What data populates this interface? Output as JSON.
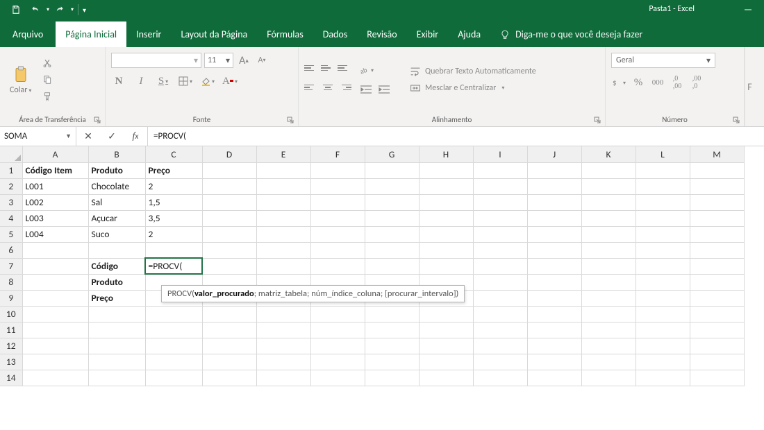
{
  "titlebar": {
    "title": "Pasta1  -  Excel"
  },
  "tabs": {
    "file": "Arquivo",
    "home": "Página Inicial",
    "insert": "Inserir",
    "page_layout": "Layout da Página",
    "formulas": "Fórmulas",
    "data": "Dados",
    "review": "Revisão",
    "view": "Exibir",
    "help": "Ajuda",
    "tell_me": "Diga-me o que você deseja fazer"
  },
  "ribbon": {
    "clipboard": {
      "paste": "Colar",
      "group": "Área de Transferência"
    },
    "font": {
      "size": "11",
      "bold": "N",
      "italic": "I",
      "underline": "S",
      "group": "Fonte",
      "grow": "A",
      "shrink": "A"
    },
    "alignment": {
      "wrap": "Quebrar Texto Automaticamente",
      "merge": "Mesclar e Centralizar",
      "group": "Alinhamento"
    },
    "number": {
      "format": "Geral",
      "group": "Número"
    },
    "edge": "F"
  },
  "namebox": "SOMA",
  "formula_bar": "=PROCV(",
  "columns": [
    "A",
    "B",
    "C",
    "D",
    "E",
    "F",
    "G",
    "H",
    "I",
    "J",
    "K",
    "L",
    "M"
  ],
  "rows": [
    "1",
    "2",
    "3",
    "4",
    "5",
    "6",
    "7",
    "8",
    "9",
    "10",
    "11",
    "12",
    "13",
    "14"
  ],
  "cells": {
    "A1": "Código Item",
    "B1": "Produto",
    "C1": "Preço",
    "A2": "L001",
    "B2": "Chocolate",
    "C2": "2",
    "A3": "L002",
    "B3": "Sal",
    "C3": "1,5",
    "A4": "L003",
    "B4": "Açucar",
    "C4": "3,5",
    "A5": "L004",
    "B5": "Suco",
    "C5": "2",
    "B7": "Código",
    "C7": "=PROCV(",
    "B8": "Produto",
    "B9": "Preço"
  },
  "tooltip": {
    "fn": "PROCV(",
    "arg1": "valor_procurado",
    "rest": "; matriz_tabela; núm_índice_coluna; [procurar_intervalo])"
  }
}
